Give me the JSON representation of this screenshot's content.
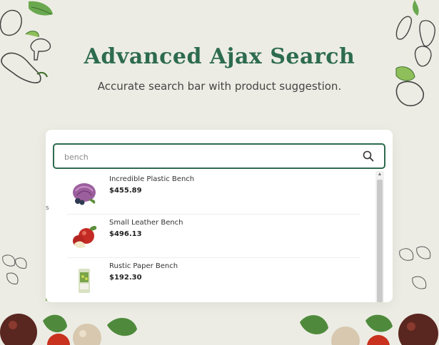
{
  "header": {
    "title": "Advanced Ajax Search",
    "subtitle": "Accurate search bar with product suggestion."
  },
  "search": {
    "value": "bench",
    "icon": "search-icon"
  },
  "results": [
    {
      "name": "Incredible Plastic Bench",
      "price": "$455.89",
      "image": "cabbage-icon"
    },
    {
      "name": "Small Leather Bench",
      "price": "$496.13",
      "image": "apple-icon"
    },
    {
      "name": "Rustic Paper Bench",
      "price": "$192.30",
      "image": "package-icon"
    }
  ],
  "colors": {
    "accent": "#2d6b4f",
    "background": "#ecece4"
  }
}
